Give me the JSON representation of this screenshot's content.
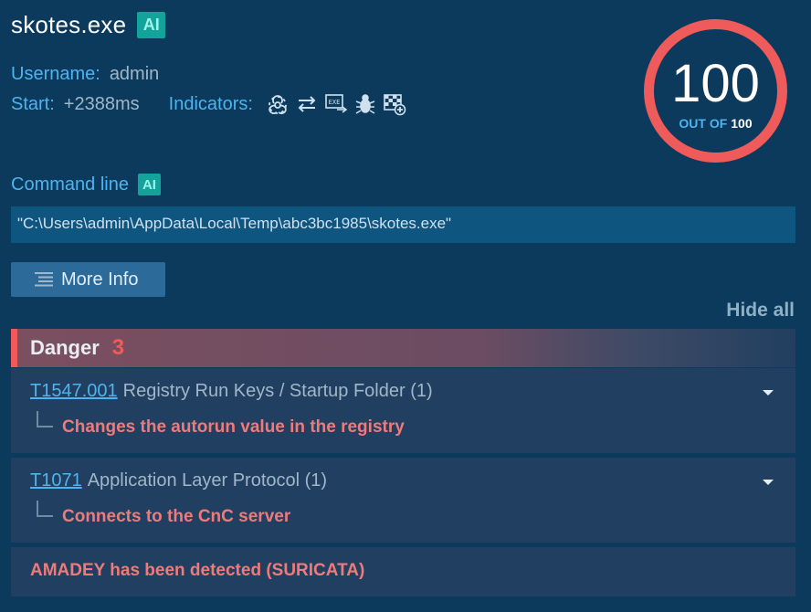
{
  "process": {
    "name": "skotes.exe",
    "ai_badge": "AI"
  },
  "meta": {
    "username_label": "Username:",
    "username_value": "admin",
    "start_label": "Start:",
    "start_value": "+2388ms",
    "indicators_label": "Indicators:",
    "indicators": [
      "biohazard-icon",
      "network-arrows-icon",
      "exe-file-icon",
      "bug-icon",
      "checkered-flag-plus-icon"
    ]
  },
  "score": {
    "value": "100",
    "out_of_label": "OUT OF",
    "max": "100",
    "ring_color": "#ef5a5a"
  },
  "command_line": {
    "label": "Command line",
    "ai_badge": "AI",
    "value": "\"C:\\Users\\admin\\AppData\\Local\\Temp\\abc3bc1985\\skotes.exe\""
  },
  "more_info_label": "More Info",
  "hide_all_label": "Hide all",
  "danger": {
    "label": "Danger",
    "count": "3",
    "accent": "#ef5a5a",
    "items": [
      {
        "technique_id": "T1547.001",
        "technique_name": "Registry Run Keys / Startup Folder (1)",
        "description": "Changes the autorun value in the registry"
      },
      {
        "technique_id": "T1071",
        "technique_name": "Application Layer Protocol (1)",
        "description": "Connects to the CnC server"
      },
      {
        "description": "AMADEY has been detected (SURICATA)"
      }
    ]
  }
}
